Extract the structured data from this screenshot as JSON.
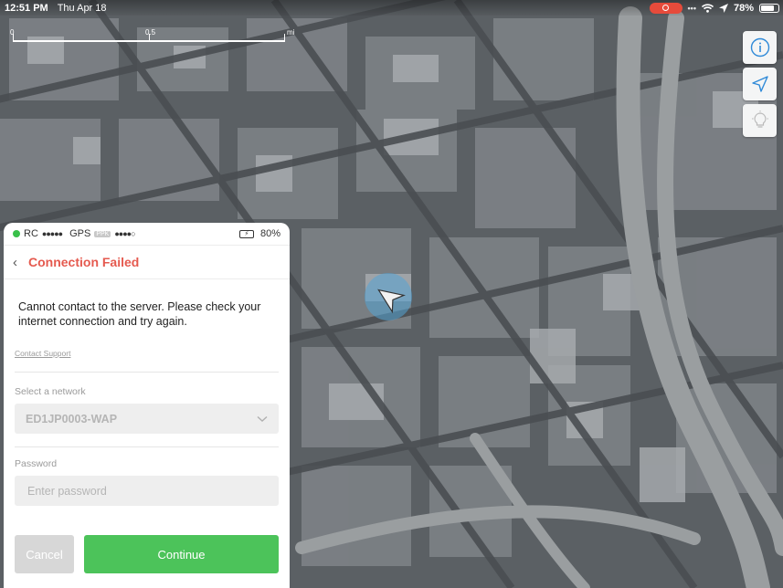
{
  "status_bar": {
    "time": "12:51 PM",
    "date": "Thu Apr 18",
    "battery": "78%",
    "battery_level": 0.78,
    "recording_color": "#e64b3b"
  },
  "map": {
    "scale_start": "0",
    "scale_mid": "0.5",
    "scale_unit": "mi"
  },
  "map_buttons": {
    "info_icon": "info-icon",
    "locate_icon": "location-arrow-icon",
    "tips_icon": "lightbulb-icon",
    "accent": "#2f8ad8"
  },
  "panel": {
    "rc_label": "RC",
    "rc_signal": "●●●●●",
    "gps_label": "GPS",
    "gps_badge": "PPK",
    "gps_signal": "●●●●○",
    "battery": "80%",
    "title": "Connection Failed",
    "title_color": "#e55a4f",
    "message": "Cannot contact to the server. Please check your internet connection and try again.",
    "support_link": "Contact Support",
    "network_label": "Select a network",
    "network_value": "ED1JP0003-WAP",
    "password_label": "Password",
    "password_placeholder": "Enter password",
    "cancel_label": "Cancel",
    "continue_label": "Continue",
    "continue_color": "#4cc35a"
  }
}
